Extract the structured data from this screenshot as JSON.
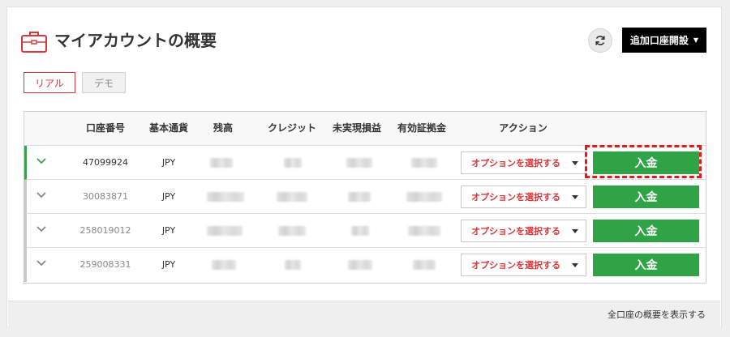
{
  "header": {
    "title": "マイアカウントの概要",
    "add_account_label": "追加口座開設",
    "briefcase_icon": "briefcase-icon",
    "refresh_icon": "refresh-icon"
  },
  "tabs": [
    {
      "label": "リアル",
      "active": true
    },
    {
      "label": "デモ",
      "active": false
    }
  ],
  "table": {
    "columns": [
      "口座番号",
      "基本通貨",
      "残高",
      "クレジット",
      "未実現損益",
      "有効証拠金",
      "アクション"
    ],
    "rows": [
      {
        "account": "47099924",
        "currency": "JPY",
        "expanded": true,
        "action_select": "オプションを選択する",
        "deposit_label": "入金"
      },
      {
        "account": "30083871",
        "currency": "JPY",
        "expanded": false,
        "action_select": "オプションを選択する",
        "deposit_label": "入金"
      },
      {
        "account": "258019012",
        "currency": "JPY",
        "expanded": false,
        "action_select": "オプションを選択する",
        "deposit_label": "入金"
      },
      {
        "account": "259008331",
        "currency": "JPY",
        "expanded": false,
        "action_select": "オプションを選択する",
        "deposit_label": "入金"
      }
    ]
  },
  "footer": {
    "link": "全口座の概要を表示する"
  },
  "colors": {
    "accent_red": "#d9383a",
    "deposit_green": "#2fa345",
    "highlight_red": "#e41b1b"
  }
}
